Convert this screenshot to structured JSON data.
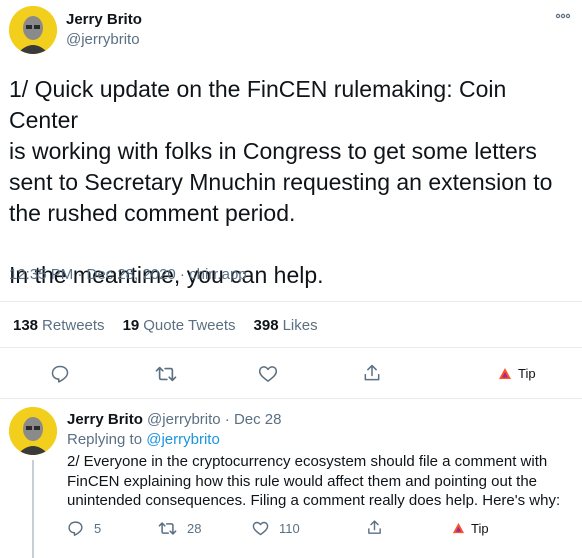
{
  "main_tweet": {
    "author_name": "Jerry Brito",
    "author_handle": "@jerrybrito",
    "text_lines": [
      "1/ Quick update on the FinCEN rulemaking: Coin Center",
      "is working with folks in Congress to get some letters",
      "sent to Secretary Mnuchin requesting an extension to",
      "the rushed comment period.",
      "",
      "In the meantime, you can help."
    ],
    "timestamp": "12:35 PM · Dec 28, 2020 · chirr.app",
    "stats": {
      "retweets_count": "138",
      "retweets_label": "Retweets",
      "quotes_count": "19",
      "quotes_label": "Quote Tweets",
      "likes_count": "398",
      "likes_label": "Likes"
    },
    "actions": {
      "tip_label": "Tip"
    }
  },
  "reply_tweet": {
    "author_name": "Jerry Brito",
    "author_handle": "@jerrybrito",
    "date": "Dec 28",
    "separator": "·",
    "replying_prefix": "Replying to",
    "replying_handle": "@jerrybrito",
    "text_lines": [
      "2/ Everyone in the cryptocurrency ecosystem should file a comment with",
      "FinCEN explaining how this rule would affect them and pointing out the",
      "unintended consequences. Filing a comment really does help. Here's why:"
    ],
    "actions": {
      "replies": "5",
      "retweets": "28",
      "likes": "110",
      "tip_label": "Tip"
    }
  },
  "icons": [
    "more-icon",
    "reply-icon",
    "retweet-icon",
    "like-icon",
    "share-icon",
    "brave-tip-icon"
  ],
  "colors": {
    "text": "#0f1419",
    "secondary": "#5b7083",
    "link": "#1b95e0",
    "divider": "#e6ecf0",
    "avatar_bg": "#f3cf1d"
  }
}
